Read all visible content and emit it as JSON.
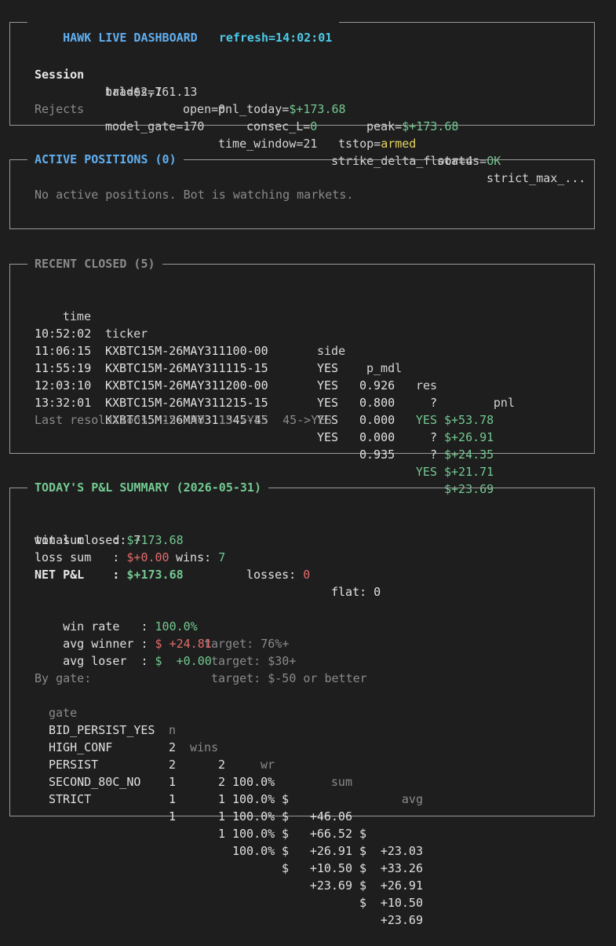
{
  "header": {
    "title": "HAWK LIVE DASHBOARD",
    "refresh": "refresh=14:02:01",
    "session_label": "Session",
    "bal": "bal=$2,161.13",
    "pnl_today_key": "pnl_today=",
    "pnl_today_val": "$+173.68",
    "peak_key": "peak=",
    "peak_val": "$+173.68",
    "trades": "trades=7",
    "open": "open=0",
    "consec_key": "consec_L=",
    "consec_val": "0",
    "tstop_key": "tstop=",
    "tstop_val": "armed",
    "status_key": "status=",
    "status_val": "OK",
    "rejects_label": "Rejects",
    "rejects": [
      "model_gate=170",
      "time_window=21",
      "strike_delta_floor=4",
      "strict_max_..."
    ]
  },
  "active": {
    "title": "ACTIVE POSITIONS (0)",
    "message": "No active positions. Bot is watching markets."
  },
  "recent": {
    "title": "RECENT CLOSED (5)",
    "columns": {
      "time": "time",
      "ticker": "ticker",
      "side": "side",
      "p_mdl": "p_mdl",
      "res": "res",
      "pnl": "pnl"
    },
    "rows": [
      {
        "time": "10:52:02",
        "ticker": "KXBTC15M-26MAY311100-00",
        "side": "YES",
        "p_mdl": "0.926",
        "res": "?",
        "pnl": "$+53.78"
      },
      {
        "time": "11:06:15",
        "ticker": "KXBTC15M-26MAY311115-15",
        "side": "YES",
        "p_mdl": "0.800",
        "res": "YES",
        "pnl": "$+26.91"
      },
      {
        "time": "11:55:19",
        "ticker": "KXBTC15M-26MAY311200-00",
        "side": "YES",
        "p_mdl": "0.000",
        "res": "?",
        "pnl": "$+24.35"
      },
      {
        "time": "12:03:10",
        "ticker": "KXBTC15M-26MAY311215-15",
        "side": "YES",
        "p_mdl": "0.000",
        "res": "?",
        "pnl": "$+21.71"
      },
      {
        "time": "13:32:01",
        "ticker": "KXBTC15M-26MAY311345-45",
        "side": "YES",
        "p_mdl": "0.935",
        "res": "YES",
        "pnl": "$+23.69"
      }
    ],
    "last_resolutions": "Last resolutions: 15->NO  15->YES  45->YES"
  },
  "summary": {
    "title": "TODAY'S P&L SUMMARY (2026-05-31)",
    "total_closed_label": "total closed: 7",
    "wins_label": "wins: ",
    "wins_val": "7",
    "losses_label": "losses: ",
    "losses_val": "0",
    "flat_label": "flat: 0",
    "win_sum_label": "win sum    : ",
    "win_sum_val": "$+173.68",
    "loss_sum_label": "loss sum   : ",
    "loss_sum_val": "$+0.00",
    "net_label": "NET P&L    : ",
    "net_val": "$+173.68",
    "win_rate_label": "win rate   : ",
    "win_rate_val": "100.0%",
    "win_rate_target": "target: 76%+",
    "avg_winner_label": "avg winner : ",
    "avg_winner_val": "$ +24.81",
    "avg_winner_target": "target: $30+",
    "avg_loser_label": "avg loser  : ",
    "avg_loser_val": "$  +0.00",
    "avg_loser_target": "target: $-50 or better",
    "by_gate_label": "By gate:",
    "gate_columns": {
      "gate": "gate",
      "n": "n",
      "wins": "wins",
      "wr": "wr",
      "sum": "sum",
      "avg": "avg"
    },
    "gates": [
      {
        "gate": "BID_PERSIST_YES",
        "n": "2",
        "wins": "2",
        "wr": "100.0%",
        "sum_cur": "$",
        "sum": "+46.06",
        "avg_cur": "$",
        "avg": "+23.03"
      },
      {
        "gate": "HIGH_CONF",
        "n": "2",
        "wins": "2",
        "wr": "100.0%",
        "sum_cur": "$",
        "sum": "+66.52",
        "avg_cur": "$",
        "avg": "+33.26"
      },
      {
        "gate": "PERSIST",
        "n": "1",
        "wins": "1",
        "wr": "100.0%",
        "sum_cur": "$",
        "sum": "+26.91",
        "avg_cur": "$",
        "avg": "+26.91"
      },
      {
        "gate": "SECOND_80C_NO",
        "n": "1",
        "wins": "1",
        "wr": "100.0%",
        "sum_cur": "$",
        "sum": "+10.50",
        "avg_cur": "$",
        "avg": "+10.50"
      },
      {
        "gate": "STRICT",
        "n": "1",
        "wins": "1",
        "wr": "100.0%",
        "sum_cur": "$",
        "sum": "+23.69",
        "avg_cur": "$",
        "avg": "+23.69"
      }
    ]
  }
}
